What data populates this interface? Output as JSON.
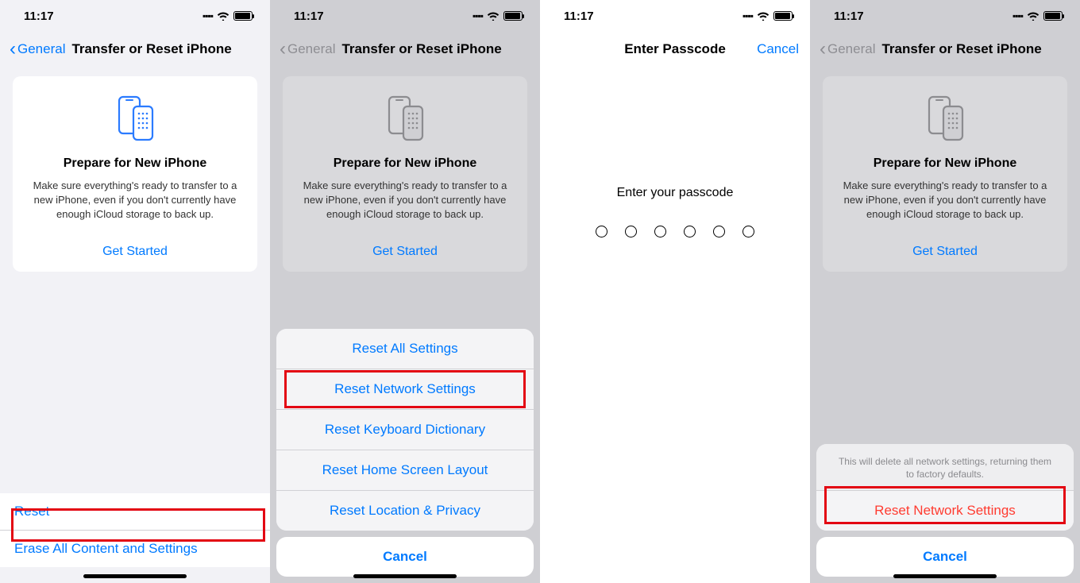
{
  "status": {
    "time": "11:17"
  },
  "nav": {
    "back": "General",
    "title": "Transfer or Reset iPhone",
    "passcode_title": "Enter Passcode",
    "cancel": "Cancel"
  },
  "card": {
    "title": "Prepare for New iPhone",
    "desc": "Make sure everything's ready to transfer to a new iPhone, even if you don't currently have enough iCloud storage to back up.",
    "cta": "Get Started"
  },
  "bottom": {
    "reset": "Reset",
    "erase": "Erase All Content and Settings"
  },
  "reset_sheet": {
    "items": [
      "Reset All Settings",
      "Reset Network Settings",
      "Reset Keyboard Dictionary",
      "Reset Home Screen Layout",
      "Reset Location & Privacy"
    ],
    "cancel": "Cancel"
  },
  "passcode": {
    "prompt": "Enter your passcode"
  },
  "confirm_sheet": {
    "note": "This will delete all network settings, returning them to factory defaults.",
    "action": "Reset Network Settings",
    "cancel": "Cancel"
  },
  "peek": "Reset"
}
